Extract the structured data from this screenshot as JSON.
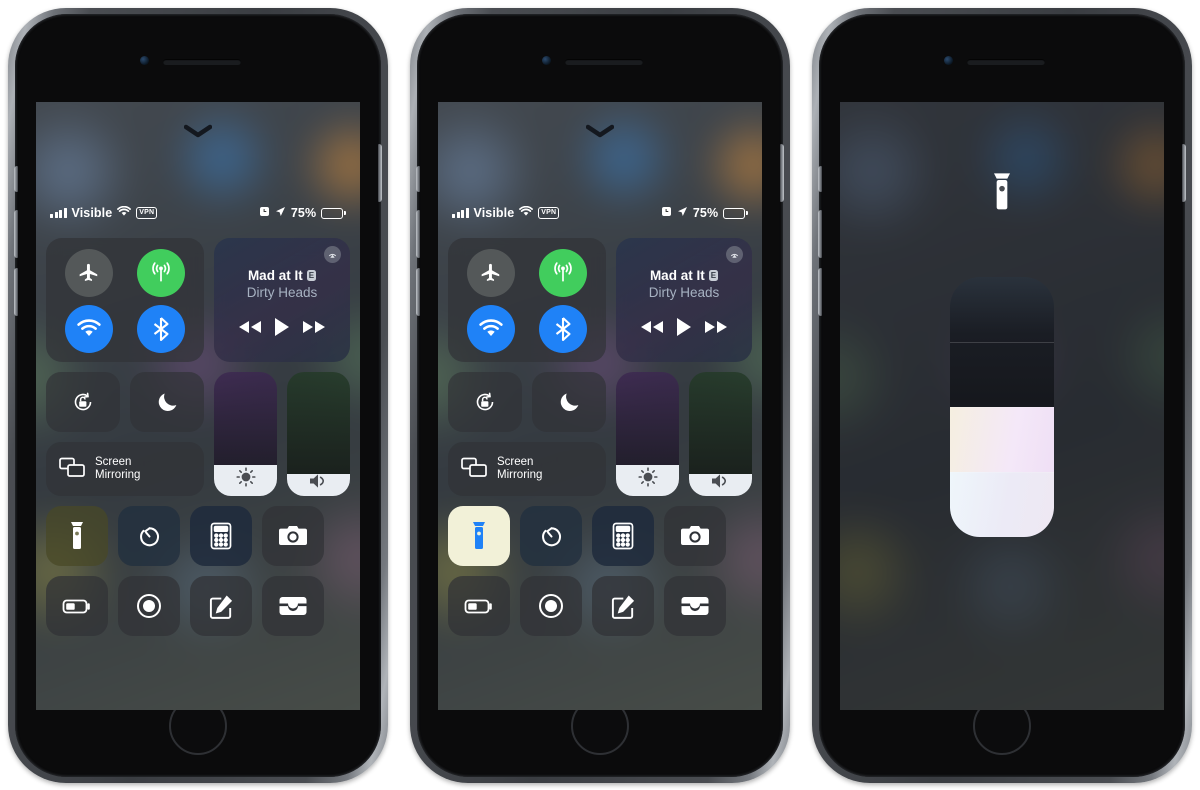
{
  "page": {
    "background": "#ffffff",
    "device": "iPhone (space gray)",
    "screens": 3
  },
  "statusbar": {
    "signal_label": "signal-bars",
    "carrier": "Visible",
    "wifi": "wifi-icon",
    "vpn": "VPN",
    "alarm": "alarm-icon",
    "location": "location-arrow",
    "battery_percent": "75%",
    "battery_level": 75
  },
  "control_center": {
    "handle": "chevron-down",
    "connectivity": {
      "airplane": {
        "name": "Airplane Mode",
        "state": "off",
        "color": "#787e7a"
      },
      "cellular": {
        "name": "Cellular Data",
        "state": "on",
        "color": "#41cd5d"
      },
      "wifi": {
        "name": "Wi-Fi",
        "state": "on",
        "color": "#1f82f7"
      },
      "bluetooth": {
        "name": "Bluetooth",
        "state": "on",
        "color": "#1f82f7"
      }
    },
    "music": {
      "title": "Mad at It",
      "explicit_badge": "E",
      "artist": "Dirty Heads",
      "airplay": "airplay-icon",
      "rewind": "rewind-icon",
      "play": "play-icon",
      "forward": "fast-forward-icon"
    },
    "rotation_lock": {
      "name": "Rotation Lock",
      "state": "off"
    },
    "do_not_disturb": {
      "name": "Do Not Disturb",
      "state": "off"
    },
    "screen_mirroring": {
      "line1": "Screen",
      "line2": "Mirroring"
    },
    "brightness": {
      "name": "Brightness",
      "value": 25
    },
    "volume": {
      "name": "Volume",
      "value": 18
    },
    "shortcuts_row1": [
      {
        "name": "Flashlight",
        "icon": "flashlight-icon",
        "state": "off"
      },
      {
        "name": "Timer",
        "icon": "timer-icon",
        "state": "off"
      },
      {
        "name": "Calculator",
        "icon": "calculator-icon",
        "state": "off"
      },
      {
        "name": "Camera",
        "icon": "camera-icon",
        "state": "off"
      }
    ],
    "shortcuts_row2": [
      {
        "name": "Low Power Mode",
        "icon": "battery-icon",
        "state": "off"
      },
      {
        "name": "Screen Recording",
        "icon": "record-icon",
        "state": "off"
      },
      {
        "name": "Notes",
        "icon": "notes-icon",
        "state": "off"
      },
      {
        "name": "Wallet",
        "icon": "wallet-icon",
        "state": "off"
      }
    ]
  },
  "screen2": {
    "note": "Flashlight toggled on",
    "flashlight_state": "on",
    "flashlight_tile_color": "#f2f1d8",
    "flashlight_icon_color": "#1f82f7"
  },
  "screen3": {
    "note": "Flashlight brightness 3D Touch panel",
    "icon": "flashlight-icon",
    "slider": {
      "segments": 4,
      "filled": 2,
      "level_label": "2 of 4"
    }
  }
}
